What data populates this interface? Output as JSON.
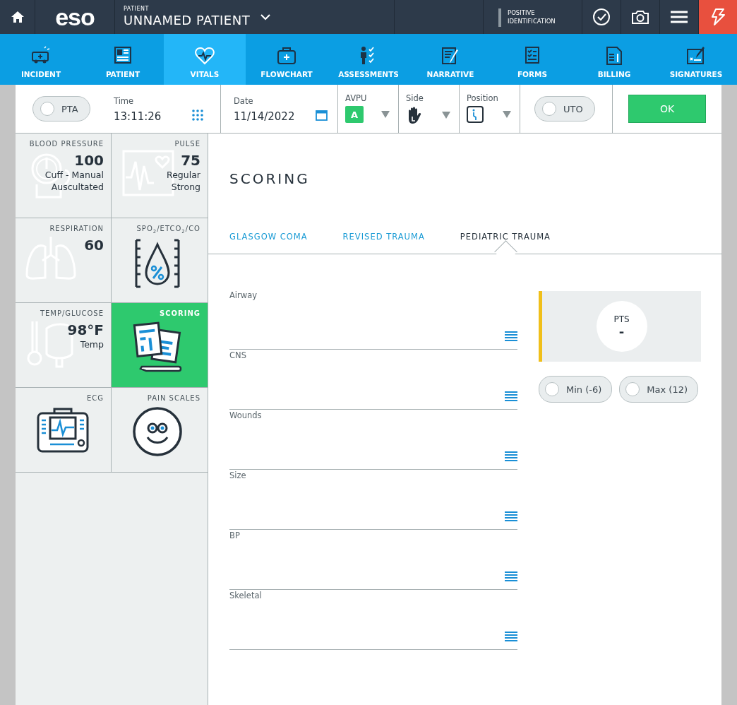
{
  "top_bar": {
    "logo": "eso",
    "patient_label": "PATIENT",
    "patient_name": "UNNAMED PATIENT",
    "identification": "POSITIVE IDENTIFICATION"
  },
  "nav_tabs": [
    {
      "label": "INCIDENT",
      "selected": false
    },
    {
      "label": "PATIENT",
      "selected": false
    },
    {
      "label": "VITALS",
      "selected": true
    },
    {
      "label": "FLOWCHART",
      "selected": false
    },
    {
      "label": "ASSESSMENTS",
      "selected": false
    },
    {
      "label": "NARRATIVE",
      "selected": false
    },
    {
      "label": "FORMS",
      "selected": false
    },
    {
      "label": "BILLING",
      "selected": false
    },
    {
      "label": "SIGNATURES",
      "selected": false
    }
  ],
  "header": {
    "pta": {
      "label": "PTA",
      "checked": false
    },
    "time": {
      "label": "Time",
      "value": "13:11:26"
    },
    "date": {
      "label": "Date",
      "value": "11/14/2022"
    },
    "avpu": {
      "label": "AVPU",
      "value": "A"
    },
    "side": {
      "label": "Side"
    },
    "position": {
      "label": "Position"
    },
    "uto": {
      "label": "UTO",
      "checked": false
    },
    "ok_button": "OK"
  },
  "tiles": [
    {
      "title": "BLOOD PRESSURE",
      "value": "100",
      "lines": [
        "Cuff - Manual",
        "Auscultated"
      ],
      "selected": false
    },
    {
      "title": "PULSE",
      "value": "75",
      "lines": [
        "Regular",
        "Strong"
      ],
      "selected": false
    },
    {
      "title": "RESPIRATION",
      "value": "60",
      "selected": false
    },
    {
      "title": "SPO$_{2}$/ETCO$_{2}$/CO",
      "selected": false
    },
    {
      "title": "TEMP/GLUCOSE",
      "value": "98°F",
      "lines": [
        "Temp"
      ],
      "selected": false
    },
    {
      "title": "SCORING",
      "selected": true
    },
    {
      "title": "ECG",
      "selected": false
    },
    {
      "title": "PAIN SCALES",
      "selected": false
    }
  ],
  "scoring": {
    "title": "SCORING",
    "tabs": [
      {
        "label": "GLASGOW COMA",
        "selected": false
      },
      {
        "label": "REVISED TRAUMA",
        "selected": false
      },
      {
        "label": "PEDIATRIC TRAUMA",
        "selected": true
      }
    ],
    "fields": [
      {
        "label": "Airway"
      },
      {
        "label": "CNS"
      },
      {
        "label": "Wounds"
      },
      {
        "label": "Size"
      },
      {
        "label": "BP"
      },
      {
        "label": "Skeletal"
      }
    ],
    "points": {
      "label": "PTS",
      "value": "-"
    },
    "options": [
      {
        "label": "Min (-6)",
        "checked": false
      },
      {
        "label": "Max (12)",
        "checked": false
      }
    ]
  }
}
